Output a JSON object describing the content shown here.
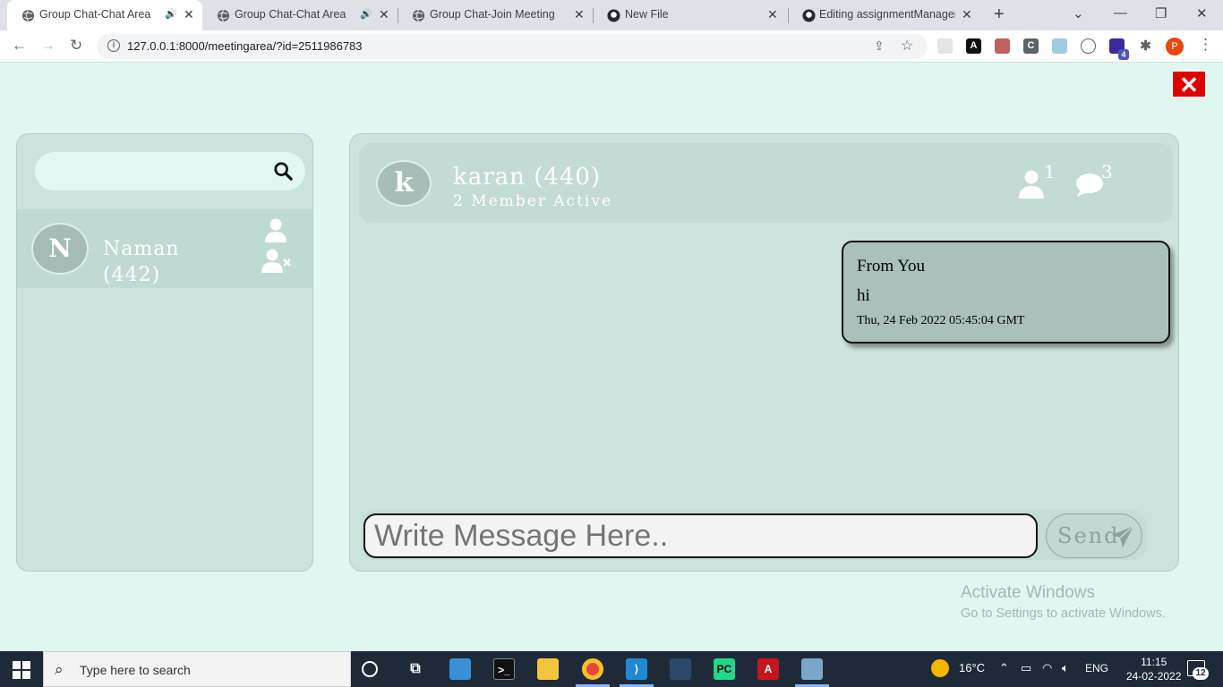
{
  "browser": {
    "tabs": [
      {
        "title": "Group Chat-Chat Area",
        "active": true,
        "audio": true
      },
      {
        "title": "Group Chat-Chat Area",
        "active": false,
        "audio": true
      },
      {
        "title": "Group Chat-Join Meeting",
        "active": false,
        "audio": false
      },
      {
        "title": "New File",
        "active": false,
        "audio": false
      },
      {
        "title": "Editing assignmentManagem",
        "active": false,
        "audio": false
      }
    ],
    "url": "127.0.0.1:8000/meetingarea/?id=2511986783",
    "profile_initial": "P",
    "extension_badge": "4"
  },
  "page": {
    "close_symbol": "✕",
    "search": {
      "placeholder": "",
      "value": ""
    },
    "members": [
      {
        "initial": "N",
        "name": "Naman (442)"
      }
    ],
    "chat_header": {
      "initial": "k",
      "title": "karan (440)",
      "subtitle": "2 Member Active",
      "member_count": "1",
      "message_count": "3"
    },
    "messages": [
      {
        "from": "From You",
        "text": "hi",
        "time": "Thu, 24 Feb 2022 05:45:04 GMT"
      }
    ],
    "composer": {
      "placeholder": "Write Message Here..",
      "send_label": "Send"
    },
    "watermark": {
      "line1": "Activate Windows",
      "line2": "Go to Settings to activate Windows."
    }
  },
  "taskbar": {
    "search_placeholder": "Type here to search",
    "weather": "16°C",
    "language": "ENG",
    "time": "11:15",
    "date": "24-02-2022",
    "notification_count": "12"
  },
  "colors": {
    "page_bg": "#dff7f0",
    "panel_bg": "#cbe3dc",
    "close_red": "#e00000",
    "bubble_bg": "#a9c0bb"
  }
}
